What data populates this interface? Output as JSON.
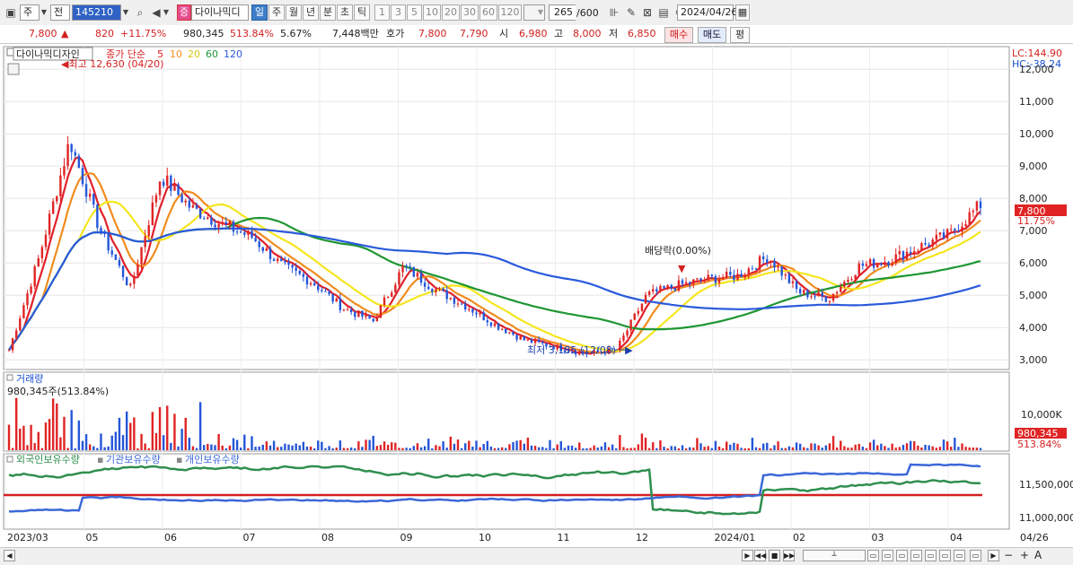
{
  "toolbar": {
    "market_type": "주",
    "scope": "전",
    "code": "145210",
    "stock_badge": "증",
    "stock_name": "다이나믹디",
    "periods": [
      "일",
      "주",
      "월",
      "년",
      "분",
      "초",
      "틱"
    ],
    "selected_period": "일",
    "intervals": [
      "1",
      "3",
      "5",
      "10",
      "20",
      "30",
      "60",
      "120"
    ],
    "bar_count": "265",
    "bar_total": "/600",
    "date": "2024/04/26"
  },
  "quote": {
    "price": "7,800",
    "arrow": "▲",
    "change": "820",
    "change_pct": "+11.75%",
    "volume": "980,345",
    "volume_ratio": "513.84%",
    "turnover": "5.67%",
    "amount": "7,448백만",
    "ask_label": "호가",
    "ask": "7,800",
    "bid": "7,790",
    "open_label": "시",
    "open": "6,980",
    "high_label": "고",
    "high": "8,000",
    "low_label": "저",
    "low": "6,850",
    "buy_button": "매수",
    "sell_button": "매도",
    "eval_button": "평"
  },
  "price_panel": {
    "stock_label": "다이나믹디자인",
    "ma_label": "종가 단순",
    "ma_periods": [
      "5",
      "10",
      "20",
      "60",
      "120"
    ],
    "ma_colors": [
      "#e0202a",
      "#f08c1e",
      "#f5e61e",
      "#1e9632",
      "#2a5adc"
    ],
    "high_marker": "최고 12,630 (04/20)",
    "low_marker": "최저 3,185 (12/08)",
    "dividend_marker": "배당락(0.00%)",
    "lc": "LC:144.90",
    "hc": "HC:-38.24",
    "last_price_tag": "7,800",
    "last_pct_tag": "11.75%",
    "y_ticks": [
      "12,000",
      "11,000",
      "10,000",
      "9,000",
      "8,000",
      "7,000",
      "6,000",
      "5,000",
      "4,000",
      "3,000"
    ]
  },
  "volume_panel": {
    "label": "거래량",
    "value": "980,345주(513.84%)",
    "y_tick": "10,000K",
    "tag_value": "980,345",
    "tag_pct": "513.84%"
  },
  "holdings_panel": {
    "series_labels": [
      "외국인보유수량",
      "기관보유수량",
      "개인보유수량"
    ],
    "series_colors": [
      "#2f8f4e",
      "#3b68d8",
      "#d42020"
    ],
    "y_ticks": [
      "11,500,000",
      "11,000,000"
    ]
  },
  "x_axis": {
    "labels": [
      "2023/03",
      "05",
      "06",
      "07",
      "08",
      "09",
      "10",
      "11",
      "12",
      "2024/01",
      "02",
      "03",
      "04"
    ],
    "end_label": "04/26"
  },
  "chart_data": {
    "type": "candlestick",
    "title": "다이나믹디자인",
    "x": [
      "2023/03",
      "05",
      "06",
      "07",
      "08",
      "09",
      "10",
      "11",
      "12",
      "2024/01",
      "02",
      "03",
      "04"
    ],
    "y_range": [
      2700,
      12700
    ],
    "approx_close_path": [
      3300,
      6200,
      9800,
      7000,
      5200,
      8700,
      7700,
      7200,
      6800,
      5900,
      5400,
      4600,
      4200,
      5900,
      5200,
      4700,
      4100,
      3600,
      3400,
      3185,
      3300,
      5000,
      5300,
      5500,
      5600,
      6200,
      5100,
      4900,
      5900,
      6100,
      6500,
      6900,
      7800
    ],
    "highest": {
      "value": 12630,
      "date": "04/20"
    },
    "lowest": {
      "value": 3185,
      "date": "12/08"
    },
    "last": {
      "price": 7800,
      "change_pct": 11.75
    }
  }
}
